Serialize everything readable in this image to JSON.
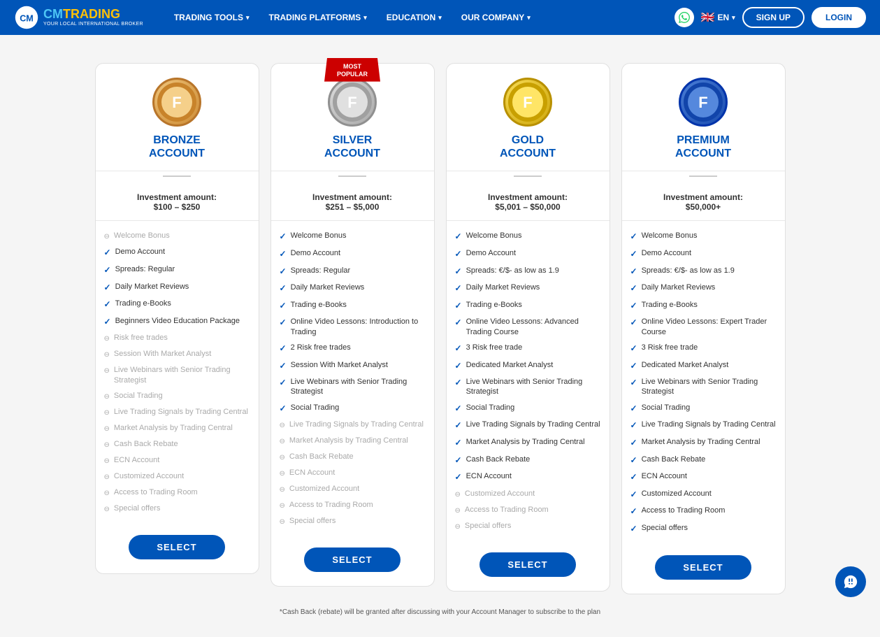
{
  "header": {
    "logo_cm": "CM",
    "logo_trading": "TRADING",
    "logo_subtitle": "YOUR LOCAL INTERNATIONAL BROKER",
    "nav": [
      {
        "label": "TRADING TOOLS",
        "id": "trading-tools"
      },
      {
        "label": "TRADING PLATFORMS",
        "id": "trading-platforms"
      },
      {
        "label": "EDUCATION",
        "id": "education"
      },
      {
        "label": "OUR COMPANY",
        "id": "our-company"
      }
    ],
    "lang": "EN",
    "signup_label": "Sign Up",
    "login_label": "Login"
  },
  "accounts": [
    {
      "id": "bronze",
      "title_line1": "BRONZE",
      "title_line2": "ACCOUNT",
      "icon_type": "bronze",
      "icon_symbol": "🏅",
      "most_popular": false,
      "investment_label": "Investment amount:",
      "investment_amount": "$100 – $250",
      "features": [
        {
          "label": "Welcome Bonus",
          "active": false
        },
        {
          "label": "Demo Account",
          "active": true
        },
        {
          "label": "Spreads: Regular",
          "active": true
        },
        {
          "label": "Daily Market Reviews",
          "active": true
        },
        {
          "label": "Trading e-Books",
          "active": true
        },
        {
          "label": "Beginners Video Education Package",
          "active": true
        },
        {
          "label": "Risk free trades",
          "active": false
        },
        {
          "label": "Session With Market Analyst",
          "active": false
        },
        {
          "label": "Live Webinars with Senior Trading Strategist",
          "active": false
        },
        {
          "label": "Social Trading",
          "active": false
        },
        {
          "label": "Live Trading Signals by Trading Central",
          "active": false
        },
        {
          "label": "Market Analysis by Trading Central",
          "active": false
        },
        {
          "label": "Cash Back Rebate",
          "active": false
        },
        {
          "label": "ECN Account",
          "active": false
        },
        {
          "label": "Customized Account",
          "active": false
        },
        {
          "label": "Access to Trading Room",
          "active": false
        },
        {
          "label": "Special offers",
          "active": false
        }
      ],
      "select_label": "SELECT"
    },
    {
      "id": "silver",
      "title_line1": "SILVER",
      "title_line2": "ACCOUNT",
      "icon_type": "silver",
      "icon_symbol": "🥈",
      "most_popular": true,
      "investment_label": "Investment amount:",
      "investment_amount": "$251 – $5,000",
      "features": [
        {
          "label": "Welcome Bonus",
          "active": true
        },
        {
          "label": "Demo Account",
          "active": true
        },
        {
          "label": "Spreads: Regular",
          "active": true
        },
        {
          "label": "Daily Market Reviews",
          "active": true
        },
        {
          "label": "Trading e-Books",
          "active": true
        },
        {
          "label": "Online Video Lessons: Introduction to Trading",
          "active": true
        },
        {
          "label": "2 Risk free trades",
          "active": true
        },
        {
          "label": "Session With Market Analyst",
          "active": true
        },
        {
          "label": "Live Webinars with Senior Trading Strategist",
          "active": true
        },
        {
          "label": "Social Trading",
          "active": true
        },
        {
          "label": "Live Trading Signals by Trading Central",
          "active": false
        },
        {
          "label": "Market Analysis by Trading Central",
          "active": false
        },
        {
          "label": "Cash Back Rebate",
          "active": false
        },
        {
          "label": "ECN Account",
          "active": false
        },
        {
          "label": "Customized Account",
          "active": false
        },
        {
          "label": "Access to Trading Room",
          "active": false
        },
        {
          "label": "Special offers",
          "active": false
        }
      ],
      "select_label": "SELECT"
    },
    {
      "id": "gold",
      "title_line1": "GOLD",
      "title_line2": "ACCOUNT",
      "icon_type": "gold",
      "icon_symbol": "🥇",
      "most_popular": false,
      "investment_label": "Investment amount:",
      "investment_amount": "$5,001 – $50,000",
      "features": [
        {
          "label": "Welcome Bonus",
          "active": true
        },
        {
          "label": "Demo Account",
          "active": true
        },
        {
          "label": "Spreads: €/$- as low as 1.9",
          "active": true
        },
        {
          "label": "Daily Market Reviews",
          "active": true
        },
        {
          "label": "Trading e-Books",
          "active": true
        },
        {
          "label": "Online Video Lessons: Advanced Trading Course",
          "active": true
        },
        {
          "label": "3 Risk free trade",
          "active": true
        },
        {
          "label": "Dedicated Market Analyst",
          "active": true
        },
        {
          "label": "Live Webinars with Senior Trading Strategist",
          "active": true
        },
        {
          "label": "Social Trading",
          "active": true
        },
        {
          "label": "Live Trading Signals by Trading Central",
          "active": true
        },
        {
          "label": "Market Analysis by Trading Central",
          "active": true
        },
        {
          "label": "Cash Back Rebate",
          "active": true
        },
        {
          "label": "ECN Account",
          "active": true
        },
        {
          "label": "Customized Account",
          "active": false
        },
        {
          "label": "Access to Trading Room",
          "active": false
        },
        {
          "label": "Special offers",
          "active": false
        }
      ],
      "select_label": "SELECT"
    },
    {
      "id": "premium",
      "title_line1": "PREMIUM",
      "title_line2": "ACCOUNT",
      "icon_type": "premium",
      "icon_symbol": "💎",
      "most_popular": false,
      "investment_label": "Investment amount:",
      "investment_amount": "$50,000+",
      "features": [
        {
          "label": "Welcome Bonus",
          "active": true
        },
        {
          "label": "Demo Account",
          "active": true
        },
        {
          "label": "Spreads: €/$- as low as 1.9",
          "active": true
        },
        {
          "label": "Daily Market Reviews",
          "active": true
        },
        {
          "label": "Trading e-Books",
          "active": true
        },
        {
          "label": "Online Video Lessons: Expert Trader Course",
          "active": true
        },
        {
          "label": "3 Risk free trade",
          "active": true
        },
        {
          "label": "Dedicated Market Analyst",
          "active": true
        },
        {
          "label": "Live Webinars with Senior Trading Strategist",
          "active": true
        },
        {
          "label": "Social Trading",
          "active": true
        },
        {
          "label": "Live Trading Signals by Trading Central",
          "active": true
        },
        {
          "label": "Market Analysis by Trading Central",
          "active": true
        },
        {
          "label": "Cash Back Rebate",
          "active": true
        },
        {
          "label": "ECN Account",
          "active": true
        },
        {
          "label": "Customized Account",
          "active": true
        },
        {
          "label": "Access to Trading Room",
          "active": true
        },
        {
          "label": "Special offers",
          "active": true
        }
      ],
      "select_label": "SELECT"
    }
  ],
  "most_popular_label": "MOST\nPOPULAR",
  "footnote": "*Cash Back (rebate) will be granted after discussing with your Account Manager to subscribe to the plan",
  "footnote_link_text": "subscribe to the plan"
}
